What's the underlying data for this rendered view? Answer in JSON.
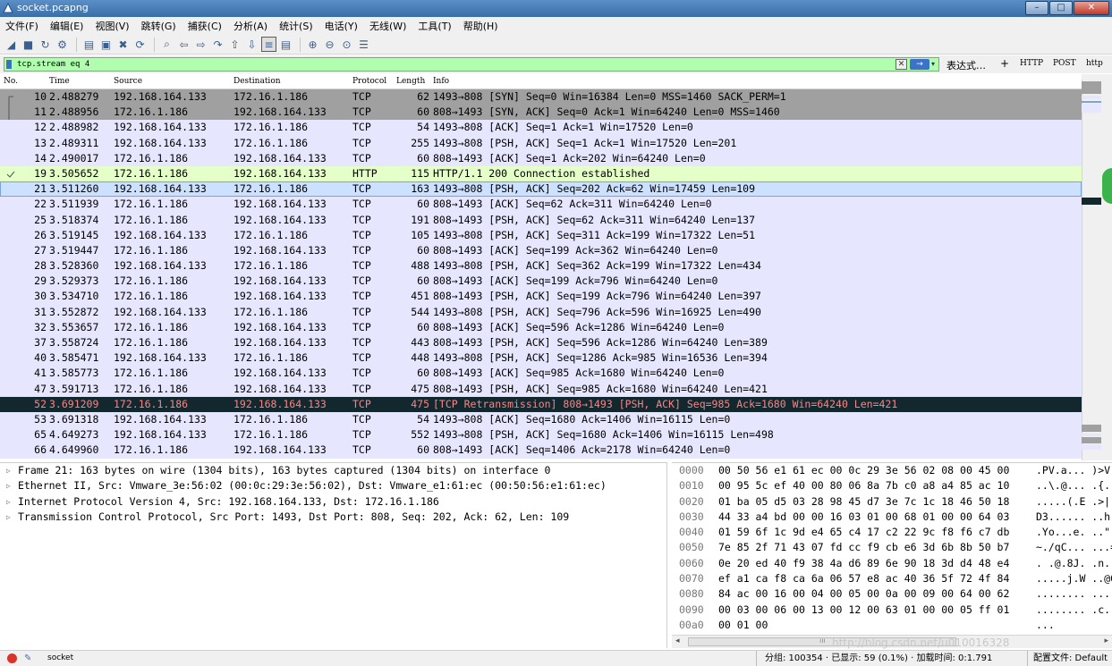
{
  "window": {
    "title": "socket.pcapng",
    "minimize": "–",
    "maximize": "□",
    "close": "✕"
  },
  "menu": [
    "文件(F)",
    "编辑(E)",
    "视图(V)",
    "跳转(G)",
    "捕获(C)",
    "分析(A)",
    "统计(S)",
    "电话(Y)",
    "无线(W)",
    "工具(T)",
    "帮助(H)"
  ],
  "toolbar": {
    "icons": [
      "shark-fin-start-icon",
      "stop-icon",
      "restart-icon",
      "options-icon",
      "|",
      "open-icon",
      "save-icon",
      "close-file-icon",
      "reload-icon",
      "|",
      "find-icon",
      "back-icon",
      "forward-icon",
      "goto-icon",
      "first-icon",
      "last-icon",
      "autoscroll-icon",
      "colorize-icon",
      "|",
      "zoom-in-icon",
      "zoom-out-icon",
      "zoom-normal-icon",
      "resize-columns-icon"
    ],
    "glyphs": [
      "◢",
      "■",
      "↻",
      "⚙",
      "|",
      "▤",
      "▣",
      "✖",
      "⟳",
      "|",
      "⌕",
      "⇦",
      "⇨",
      "↷",
      "⇧",
      "⇩",
      "≡",
      "▤",
      "|",
      "⊕",
      "⊖",
      "⊙",
      "☰"
    ]
  },
  "filter": {
    "value": "tcp.stream eq 4",
    "clear_glyph": "✕",
    "apply_glyph": "→",
    "dropdown_glyph": "▾",
    "expression_label": "表达式…",
    "plus_label": "+",
    "quick_buttons": [
      "HTTP",
      "POST",
      "http"
    ]
  },
  "columns": {
    "no": "No.",
    "time": "Time",
    "source": "Source",
    "destination": "Destination",
    "protocol": "Protocol",
    "length": "Length",
    "info": "Info"
  },
  "colors": {
    "syn_bg": "#a0a0a0",
    "tcp_bg": "#e7e6ff",
    "http_bg": "#e4ffc7",
    "selected_bg": "#cce0ff",
    "retrans_bg": "#12272e",
    "retrans_fg": "#f78787",
    "filter_bg": "#afffaf"
  },
  "packets": [
    {
      "no": "10",
      "time": "2.488279",
      "src": "192.168.164.133",
      "dst": "172.16.1.186",
      "proto": "TCP",
      "len": "62",
      "info": "1493→808 [SYN] Seq=0 Win=16384 Len=0 MSS=1460 SACK_PERM=1",
      "style": "syn"
    },
    {
      "no": "11",
      "time": "2.488956",
      "src": "172.16.1.186",
      "dst": "192.168.164.133",
      "proto": "TCP",
      "len": "60",
      "info": "808→1493 [SYN, ACK] Seq=0 Ack=1 Win=64240 Len=0 MSS=1460",
      "style": "syn"
    },
    {
      "no": "12",
      "time": "2.488982",
      "src": "192.168.164.133",
      "dst": "172.16.1.186",
      "proto": "TCP",
      "len": "54",
      "info": "1493→808 [ACK] Seq=1 Ack=1 Win=17520 Len=0",
      "style": "tcp"
    },
    {
      "no": "13",
      "time": "2.489311",
      "src": "192.168.164.133",
      "dst": "172.16.1.186",
      "proto": "TCP",
      "len": "255",
      "info": "1493→808 [PSH, ACK] Seq=1 Ack=1 Win=17520 Len=201",
      "style": "tcp"
    },
    {
      "no": "14",
      "time": "2.490017",
      "src": "172.16.1.186",
      "dst": "192.168.164.133",
      "proto": "TCP",
      "len": "60",
      "info": "808→1493 [ACK] Seq=1 Ack=202 Win=64240 Len=0",
      "style": "tcp"
    },
    {
      "no": "19",
      "time": "3.505652",
      "src": "172.16.1.186",
      "dst": "192.168.164.133",
      "proto": "HTTP",
      "len": "115",
      "info": "HTTP/1.1 200 Connection established",
      "style": "http"
    },
    {
      "no": "21",
      "time": "3.511260",
      "src": "192.168.164.133",
      "dst": "172.16.1.186",
      "proto": "TCP",
      "len": "163",
      "info": "1493→808 [PSH, ACK] Seq=202 Ack=62 Win=17459 Len=109",
      "style": "selected"
    },
    {
      "no": "22",
      "time": "3.511939",
      "src": "172.16.1.186",
      "dst": "192.168.164.133",
      "proto": "TCP",
      "len": "60",
      "info": "808→1493 [ACK] Seq=62 Ack=311 Win=64240 Len=0",
      "style": "tcp"
    },
    {
      "no": "25",
      "time": "3.518374",
      "src": "172.16.1.186",
      "dst": "192.168.164.133",
      "proto": "TCP",
      "len": "191",
      "info": "808→1493 [PSH, ACK] Seq=62 Ack=311 Win=64240 Len=137",
      "style": "tcp"
    },
    {
      "no": "26",
      "time": "3.519145",
      "src": "192.168.164.133",
      "dst": "172.16.1.186",
      "proto": "TCP",
      "len": "105",
      "info": "1493→808 [PSH, ACK] Seq=311 Ack=199 Win=17322 Len=51",
      "style": "tcp"
    },
    {
      "no": "27",
      "time": "3.519447",
      "src": "172.16.1.186",
      "dst": "192.168.164.133",
      "proto": "TCP",
      "len": "60",
      "info": "808→1493 [ACK] Seq=199 Ack=362 Win=64240 Len=0",
      "style": "tcp"
    },
    {
      "no": "28",
      "time": "3.528360",
      "src": "192.168.164.133",
      "dst": "172.16.1.186",
      "proto": "TCP",
      "len": "488",
      "info": "1493→808 [PSH, ACK] Seq=362 Ack=199 Win=17322 Len=434",
      "style": "tcp"
    },
    {
      "no": "29",
      "time": "3.529373",
      "src": "172.16.1.186",
      "dst": "192.168.164.133",
      "proto": "TCP",
      "len": "60",
      "info": "808→1493 [ACK] Seq=199 Ack=796 Win=64240 Len=0",
      "style": "tcp"
    },
    {
      "no": "30",
      "time": "3.534710",
      "src": "172.16.1.186",
      "dst": "192.168.164.133",
      "proto": "TCP",
      "len": "451",
      "info": "808→1493 [PSH, ACK] Seq=199 Ack=796 Win=64240 Len=397",
      "style": "tcp"
    },
    {
      "no": "31",
      "time": "3.552872",
      "src": "192.168.164.133",
      "dst": "172.16.1.186",
      "proto": "TCP",
      "len": "544",
      "info": "1493→808 [PSH, ACK] Seq=796 Ack=596 Win=16925 Len=490",
      "style": "tcp"
    },
    {
      "no": "32",
      "time": "3.553657",
      "src": "172.16.1.186",
      "dst": "192.168.164.133",
      "proto": "TCP",
      "len": "60",
      "info": "808→1493 [ACK] Seq=596 Ack=1286 Win=64240 Len=0",
      "style": "tcp"
    },
    {
      "no": "37",
      "time": "3.558724",
      "src": "172.16.1.186",
      "dst": "192.168.164.133",
      "proto": "TCP",
      "len": "443",
      "info": "808→1493 [PSH, ACK] Seq=596 Ack=1286 Win=64240 Len=389",
      "style": "tcp"
    },
    {
      "no": "40",
      "time": "3.585471",
      "src": "192.168.164.133",
      "dst": "172.16.1.186",
      "proto": "TCP",
      "len": "448",
      "info": "1493→808 [PSH, ACK] Seq=1286 Ack=985 Win=16536 Len=394",
      "style": "tcp"
    },
    {
      "no": "41",
      "time": "3.585773",
      "src": "172.16.1.186",
      "dst": "192.168.164.133",
      "proto": "TCP",
      "len": "60",
      "info": "808→1493 [ACK] Seq=985 Ack=1680 Win=64240 Len=0",
      "style": "tcp"
    },
    {
      "no": "47",
      "time": "3.591713",
      "src": "172.16.1.186",
      "dst": "192.168.164.133",
      "proto": "TCP",
      "len": "475",
      "info": "808→1493 [PSH, ACK] Seq=985 Ack=1680 Win=64240 Len=421",
      "style": "tcp"
    },
    {
      "no": "52",
      "time": "3.691209",
      "src": "172.16.1.186",
      "dst": "192.168.164.133",
      "proto": "TCP",
      "len": "475",
      "info": "[TCP Retransmission] 808→1493 [PSH, ACK] Seq=985 Ack=1680 Win=64240 Len=421",
      "style": "retrans"
    },
    {
      "no": "53",
      "time": "3.691318",
      "src": "192.168.164.133",
      "dst": "172.16.1.186",
      "proto": "TCP",
      "len": "54",
      "info": "1493→808 [ACK] Seq=1680 Ack=1406 Win=16115 Len=0",
      "style": "tcp"
    },
    {
      "no": "65",
      "time": "4.649273",
      "src": "192.168.164.133",
      "dst": "172.16.1.186",
      "proto": "TCP",
      "len": "552",
      "info": "1493→808 [PSH, ACK] Seq=1680 Ack=1406 Win=16115 Len=498",
      "style": "tcp"
    },
    {
      "no": "66",
      "time": "4.649960",
      "src": "172.16.1.186",
      "dst": "192.168.164.133",
      "proto": "TCP",
      "len": "60",
      "info": "808→1493 [ACK] Seq=1406 Ack=2178 Win=64240 Len=0",
      "style": "tcp"
    }
  ],
  "details": [
    "Frame 21: 163 bytes on wire (1304 bits), 163 bytes captured (1304 bits) on interface 0",
    "Ethernet II, Src: Vmware_3e:56:02 (00:0c:29:3e:56:02), Dst: Vmware_e1:61:ec (00:50:56:e1:61:ec)",
    "Internet Protocol Version 4, Src: 192.168.164.133, Dst: 172.16.1.186",
    "Transmission Control Protocol, Src Port: 1493, Dst Port: 808, Seq: 202, Ack: 62, Len: 109"
  ],
  "bytes": [
    {
      "off": "0000",
      "hex": "00 50 56 e1 61 ec 00 0c  29 3e 56 02 08 00 45 00",
      "asc": ".PV.a... )>V"
    },
    {
      "off": "0010",
      "hex": "00 95 5c ef 40 00 80 06  8a 7b c0 a8 a4 85 ac 10",
      "asc": "..\\.@... .{."
    },
    {
      "off": "0020",
      "hex": "01 ba 05 d5 03 28 98 45  d7 3e 7c 1c 18 46 50 18",
      "asc": ".....(.E .>|"
    },
    {
      "off": "0030",
      "hex": "44 33 a4 bd 00 00 16 03  01 00 68 01 00 00 64 03",
      "asc": "D3...... ..h"
    },
    {
      "off": "0040",
      "hex": "01 59 6f 1c 9d e4 65 c4  17 c2 22 9c f8 f6 c7 db",
      "asc": ".Yo...e. ..\""
    },
    {
      "off": "0050",
      "hex": "7e 85 2f 71 43 07 fd cc  f9 cb e6 3d 6b 8b 50 b7",
      "asc": "~./qC... ...="
    },
    {
      "off": "0060",
      "hex": "0e 20 ed 40 f9 38 4a d6  89 6e 90 18 3d d4 48 e4",
      "asc": ". .@.8J. .n.."
    },
    {
      "off": "0070",
      "hex": "ef a1 ca f8 ca 6a 06 57  e8 ac 40 36 5f 72 4f 84",
      "asc": ".....j.W ..@6"
    },
    {
      "off": "0080",
      "hex": "84 ac 00 16 00 04 00 05  00 0a 00 09 00 64 00 62",
      "asc": "........ ...."
    },
    {
      "off": "0090",
      "hex": "00 03 00 06 00 13 00 12  00 63 01 00 00 05 ff 01",
      "asc": "........ .c.."
    },
    {
      "off": "00a0",
      "hex": "00 01 00",
      "asc": "..."
    }
  ],
  "watermark": "http://blog.csdn.net/u010016328",
  "status": {
    "edit_glyph": "✎",
    "file": "socket",
    "stats": "分组: 100354 · 已显示: 59 (0.1%) · 加载时间: 0:1.791",
    "profile": "配置文件: Default"
  }
}
